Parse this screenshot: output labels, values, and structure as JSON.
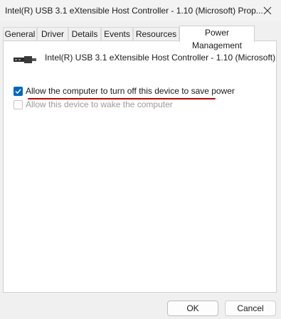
{
  "window": {
    "title": "Intel(R) USB 3.1 eXtensible Host Controller - 1.10 (Microsoft) Prop..."
  },
  "tabs": [
    {
      "label": "General"
    },
    {
      "label": "Driver"
    },
    {
      "label": "Details"
    },
    {
      "label": "Events"
    },
    {
      "label": "Resources"
    },
    {
      "label": "Power Management",
      "active": true
    }
  ],
  "device": {
    "icon": "usb-connector-icon",
    "name": "Intel(R) USB 3.1 eXtensible Host Controller - 1.10 (Microsoft)"
  },
  "options": [
    {
      "label": "Allow the computer to turn off this device to save power",
      "checked": true,
      "enabled": true
    },
    {
      "label": "Allow this device to wake the computer",
      "checked": false,
      "enabled": false
    }
  ],
  "buttons": {
    "ok": "OK",
    "cancel": "Cancel"
  },
  "colors": {
    "accent": "#0067c0",
    "annotation": "#c00000"
  }
}
